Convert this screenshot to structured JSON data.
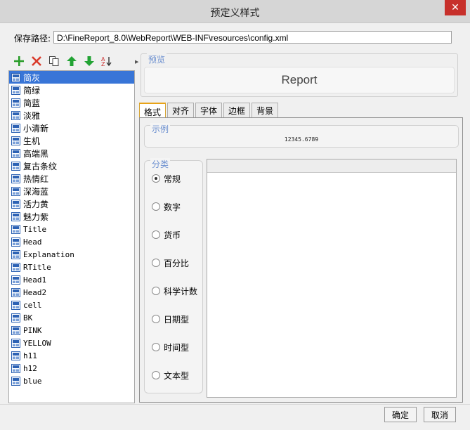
{
  "window": {
    "title": "预定义样式",
    "close_label": "✕"
  },
  "path": {
    "label": "保存路径:",
    "value": "D:\\FineReport_8.0\\WebReport\\WEB-INF\\resources\\config.xml"
  },
  "toolbar": [
    "add-icon",
    "delete-icon",
    "copy-icon",
    "move-up-icon",
    "move-down-icon",
    "sort-icon"
  ],
  "styles": {
    "selected": "简灰",
    "items": [
      "简灰",
      "简绿",
      "简蓝",
      "淡雅",
      "小清新",
      "生机",
      "高端黑",
      "复古条纹",
      "热情红",
      "深海蓝",
      "活力黄",
      "魅力紫",
      "Title",
      "Head",
      "Explanation",
      "RTitle",
      "Head1",
      "Head2",
      "cell",
      "BK",
      "PINK",
      "YELLOW",
      "h11",
      "h12",
      "blue"
    ]
  },
  "preview": {
    "title": "预览",
    "text": "Report"
  },
  "tabs": [
    "格式",
    "对齐",
    "字体",
    "边框",
    "背景"
  ],
  "active_tab": "格式",
  "example": {
    "title": "示例",
    "value": "12345.6789"
  },
  "category": {
    "title": "分类",
    "selected": "常规",
    "options": [
      "常规",
      "数字",
      "货币",
      "百分比",
      "科学计数",
      "日期型",
      "时间型",
      "文本型"
    ]
  },
  "buttons": {
    "ok": "确定",
    "cancel": "取消"
  },
  "colors": {
    "selection": "#3875d7",
    "accent_tab": "#e8a317",
    "group_title": "#6b8fcf"
  }
}
